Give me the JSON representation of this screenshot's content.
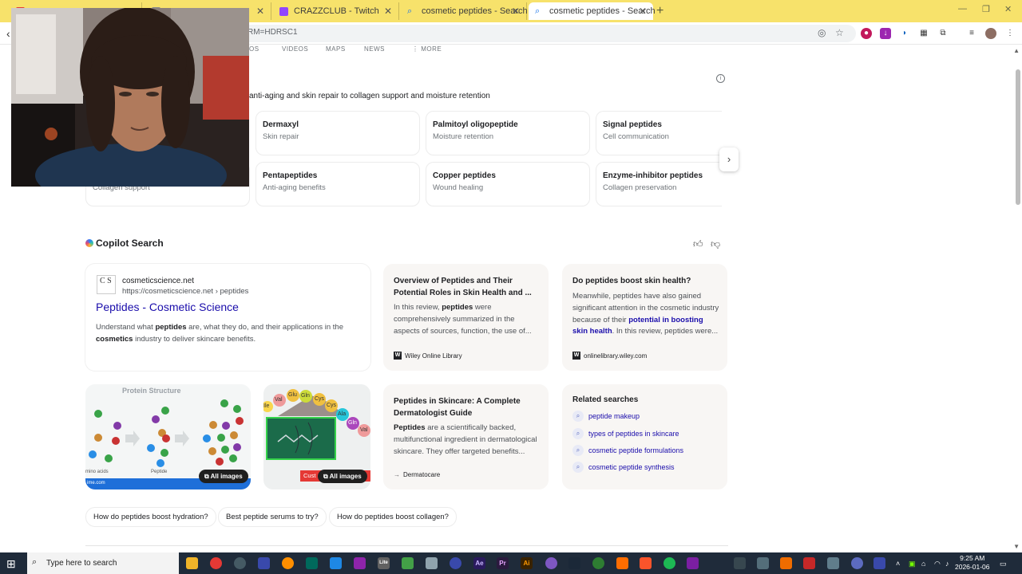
{
  "browser": {
    "tabs": [
      {
        "title": "",
        "icon": "red-icon",
        "color": "#e53935"
      },
      {
        "title": "",
        "icon": "generic-icon",
        "color": "#888888"
      },
      {
        "title": "CRAZZCLUB - Twitch",
        "icon": "twitch-icon",
        "color": "#9146ff"
      },
      {
        "title": "cosmetic peptides - Search",
        "icon": "search-icon",
        "color": "#1a73e8"
      },
      {
        "title": "cosmetic peptides - Search",
        "icon": "search-icon",
        "color": "#1a73e8"
      }
    ],
    "new_tab": "+",
    "url": "RM=HDRSC1"
  },
  "nav_fragments": [
    "OS",
    "VIDEOS",
    "MAPS",
    "NEWS",
    "⋮ MORE"
  ],
  "peptides": {
    "subtitle": "anti-aging and skin repair to collagen support and moisture retention",
    "cards": [
      {
        "title": "Dermaxyl",
        "sub": "Skin repair"
      },
      {
        "title": "Palmitoyl oligopeptide",
        "sub": "Moisture retention"
      },
      {
        "title": "Signal peptides",
        "sub": "Cell communication"
      },
      {
        "title": "",
        "sub": "Collagen support"
      },
      {
        "title": "Pentapeptides",
        "sub": "Anti-aging benefits"
      },
      {
        "title": "Copper peptides",
        "sub": "Wound healing"
      },
      {
        "title": "Enzyme-inhibitor peptides",
        "sub": "Collagen preservation"
      }
    ]
  },
  "copilot": {
    "title": "Copilot Search",
    "main": {
      "logo": "C S",
      "site": "cosmeticscience.net",
      "url": "https://cosmeticscience.net › peptides",
      "link": "Peptides - Cosmetic Science",
      "snippet_parts": [
        "Understand what ",
        "peptides",
        " are, what they do, and their applications in the ",
        "cosmetics",
        " industry to deliver skincare benefits."
      ]
    },
    "card1": {
      "title": "Overview of Peptides and Their Potential Roles in Skin Health and ...",
      "snippet_parts": [
        "In this review, ",
        "peptides",
        " were comprehensively summarized in the aspects of sources, function, the use of..."
      ],
      "source": "Wiley Online Library"
    },
    "card2": {
      "title": "Do peptides boost skin health?",
      "snippet_parts": [
        "Meanwhile, peptides have also gained significant attention in the cosmetic industry because of their ",
        "potential in boosting skin health",
        ". In this review, peptides were..."
      ],
      "source": "onlinelibrary.wiley.com"
    },
    "card3": {
      "title": "Peptides in Skincare: A Complete Dermatologist Guide",
      "snippet_parts": [
        "Peptides",
        " are a scientifically backed, multifunctional ingredient in dermatological skincare. They offer targeted benefits..."
      ],
      "source": "Dermatocare"
    },
    "image1": {
      "caption": "Protein Structure",
      "left_label": "mino acids",
      "mid_label": "Peptide",
      "foot": "ime.com",
      "button": "All images"
    },
    "image2": {
      "amino_labels": [
        "Ile",
        "Val",
        "Glu",
        "Gln",
        "Cys",
        "Cys",
        "Ala",
        "Gln",
        "Val"
      ],
      "banner": "Cust",
      "banner_end": "h",
      "button": "All images"
    },
    "related": {
      "title": "Related searches",
      "items": [
        "peptide makeup",
        "types of peptides in skincare",
        "cosmetic peptide formulations",
        "cosmetic peptide synthesis"
      ]
    },
    "chips": [
      "How do peptides boost hydration?",
      "Best peptide serums to try?",
      "How do peptides boost collagen?"
    ]
  },
  "taskbar": {
    "search_placeholder": "Type here to search",
    "time": "9:25 AM",
    "date": "2026-01-06",
    "apps": [
      "Lite",
      "Ae",
      "Pr",
      "Ai"
    ]
  },
  "colors": {
    "titlebar": "#f7e26b",
    "link": "#1a0dab",
    "taskbar": "#1f2b3a"
  }
}
